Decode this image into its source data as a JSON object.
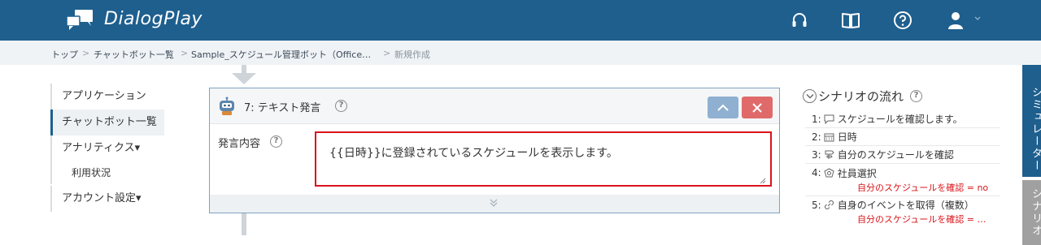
{
  "header": {
    "app_title": "DialogPlay",
    "icons": [
      "headset-icon",
      "book-icon",
      "help-circle-icon",
      "user-icon",
      "chevron-down-icon"
    ]
  },
  "breadcrumb": {
    "items": [
      "トップ",
      "チャットボット一覧",
      "Sample_スケジュール管理ボット（Office…",
      "新規作成"
    ],
    "separator": ">"
  },
  "leftnav": {
    "items": [
      "アプリケーション",
      "チャットボット一覧",
      "アナリティクス▾",
      "利用状況",
      "アカウント設定▾"
    ]
  },
  "card": {
    "title": "7: テキスト発言",
    "field_label": "発言内容",
    "text_value": "{{日時}}に登録されているスケジュールを表示します。"
  },
  "scenario": {
    "title": "シナリオの流れ",
    "items": [
      {
        "num": "1:",
        "icon": "speech-bubble-icon",
        "label": "スケジュールを確認します。"
      },
      {
        "num": "2:",
        "icon": "calendar-icon",
        "label": "日時"
      },
      {
        "num": "3:",
        "icon": "signpost-icon",
        "label": "自分のスケジュールを確認"
      },
      {
        "num": "4:",
        "icon": "badge-icon",
        "label": "社員選択",
        "condition": "自分のスケジュールを確認 = no"
      },
      {
        "num": "5:",
        "icon": "link-icon",
        "label": "自身のイベントを取得（複数）",
        "condition": "自分のスケジュールを確認 = …"
      }
    ]
  },
  "side_tabs": {
    "simulator": "シミュレーター",
    "scenario": "シナリオ"
  },
  "colors": {
    "header_bg": "#1e5f8e",
    "highlight_border": "#d9141a",
    "condition_text": "#d9141a",
    "up_button": "#8fb0d0",
    "close_button": "#e06a6a"
  }
}
